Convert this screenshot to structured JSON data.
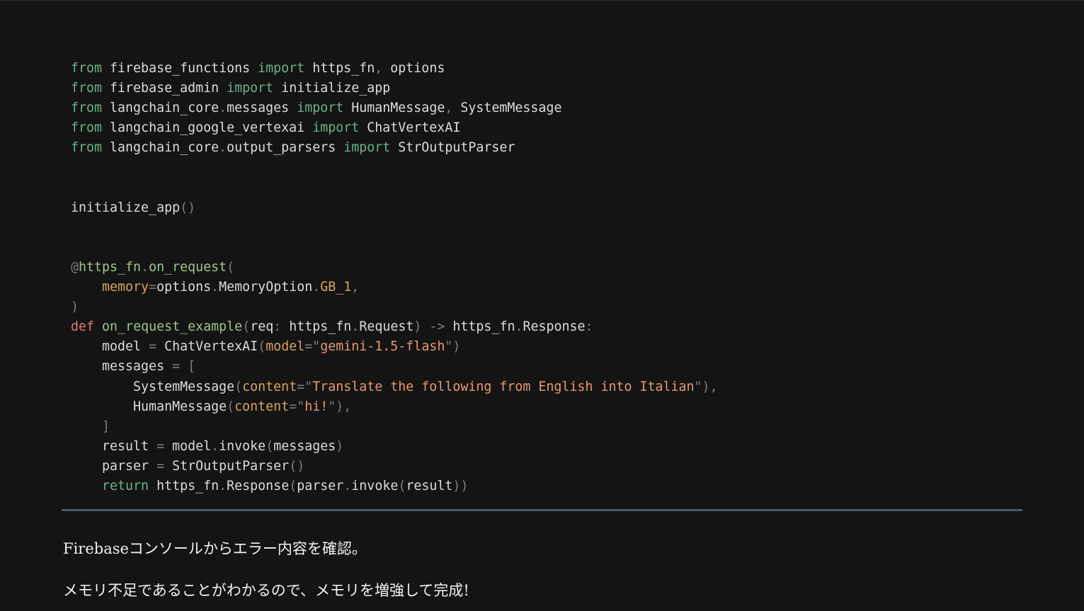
{
  "code": {
    "lines": [
      [
        [
          "kw",
          "from"
        ],
        [
          "name",
          " firebase_functions "
        ],
        [
          "kw",
          "import"
        ],
        [
          "name",
          " https_fn"
        ],
        [
          "punct",
          ","
        ],
        [
          "name",
          " options"
        ]
      ],
      [
        [
          "kw",
          "from"
        ],
        [
          "name",
          " firebase_admin "
        ],
        [
          "kw",
          "import"
        ],
        [
          "name",
          " initialize_app"
        ]
      ],
      [
        [
          "kw",
          "from"
        ],
        [
          "name",
          " langchain_core"
        ],
        [
          "punct",
          "."
        ],
        [
          "name",
          "messages "
        ],
        [
          "kw",
          "import"
        ],
        [
          "name",
          " HumanMessage"
        ],
        [
          "punct",
          ","
        ],
        [
          "name",
          " SystemMessage"
        ]
      ],
      [
        [
          "kw",
          "from"
        ],
        [
          "name",
          " langchain_google_vertexai "
        ],
        [
          "kw",
          "import"
        ],
        [
          "name",
          " ChatVertexAI"
        ]
      ],
      [
        [
          "kw",
          "from"
        ],
        [
          "name",
          " langchain_core"
        ],
        [
          "punct",
          "."
        ],
        [
          "name",
          "output_parsers "
        ],
        [
          "kw",
          "import"
        ],
        [
          "name",
          " StrOutputParser"
        ]
      ],
      [],
      [],
      [
        [
          "name",
          "initialize_app"
        ],
        [
          "punct",
          "()"
        ]
      ],
      [],
      [],
      [
        [
          "punct",
          "@"
        ],
        [
          "fn",
          "https_fn"
        ],
        [
          "punct",
          "."
        ],
        [
          "fn",
          "on_request"
        ],
        [
          "punct",
          "("
        ]
      ],
      [
        [
          "name",
          "    "
        ],
        [
          "param",
          "memory"
        ],
        [
          "punct",
          "="
        ],
        [
          "name",
          "options"
        ],
        [
          "punct",
          "."
        ],
        [
          "name",
          "MemoryOption"
        ],
        [
          "punct",
          "."
        ],
        [
          "attr",
          "GB_1"
        ],
        [
          "punct",
          ","
        ]
      ],
      [
        [
          "punct",
          ")"
        ]
      ],
      [
        [
          "kw2",
          "def"
        ],
        [
          "name",
          " "
        ],
        [
          "fn",
          "on_request_example"
        ],
        [
          "punct",
          "("
        ],
        [
          "name",
          "req"
        ],
        [
          "punct",
          ":"
        ],
        [
          "name",
          " https_fn"
        ],
        [
          "punct",
          "."
        ],
        [
          "name",
          "Request"
        ],
        [
          "punct",
          ")"
        ],
        [
          "name",
          " "
        ],
        [
          "punct",
          "->"
        ],
        [
          "name",
          " https_fn"
        ],
        [
          "punct",
          "."
        ],
        [
          "name",
          "Response"
        ],
        [
          "punct",
          ":"
        ]
      ],
      [
        [
          "name",
          "    model "
        ],
        [
          "punct",
          "="
        ],
        [
          "name",
          " ChatVertexAI"
        ],
        [
          "punct",
          "("
        ],
        [
          "param",
          "model"
        ],
        [
          "punct",
          "=\""
        ],
        [
          "str",
          "gemini-1.5-flash"
        ],
        [
          "punct",
          "\")"
        ]
      ],
      [
        [
          "name",
          "    messages "
        ],
        [
          "punct",
          "="
        ],
        [
          "name",
          " "
        ],
        [
          "punct",
          "["
        ]
      ],
      [
        [
          "name",
          "        SystemMessage"
        ],
        [
          "punct",
          "("
        ],
        [
          "param",
          "content"
        ],
        [
          "punct",
          "=\""
        ],
        [
          "str",
          "Translate the following from English into Italian"
        ],
        [
          "punct",
          "\"),"
        ]
      ],
      [
        [
          "name",
          "        HumanMessage"
        ],
        [
          "punct",
          "("
        ],
        [
          "param",
          "content"
        ],
        [
          "punct",
          "=\""
        ],
        [
          "str",
          "hi!"
        ],
        [
          "punct",
          "\"),"
        ]
      ],
      [
        [
          "name",
          "    "
        ],
        [
          "punct",
          "]"
        ]
      ],
      [
        [
          "name",
          "    result "
        ],
        [
          "punct",
          "="
        ],
        [
          "name",
          " model"
        ],
        [
          "punct",
          "."
        ],
        [
          "name",
          "invoke"
        ],
        [
          "punct",
          "("
        ],
        [
          "name",
          "messages"
        ],
        [
          "punct",
          ")"
        ]
      ],
      [
        [
          "name",
          "    parser "
        ],
        [
          "punct",
          "="
        ],
        [
          "name",
          " StrOutputParser"
        ],
        [
          "punct",
          "()"
        ]
      ],
      [
        [
          "name",
          "    "
        ],
        [
          "kw",
          "return"
        ],
        [
          "name",
          " https_fn"
        ],
        [
          "punct",
          "."
        ],
        [
          "name",
          "Response"
        ],
        [
          "punct",
          "("
        ],
        [
          "name",
          "parser"
        ],
        [
          "punct",
          "."
        ],
        [
          "name",
          "invoke"
        ],
        [
          "punct",
          "("
        ],
        [
          "name",
          "result"
        ],
        [
          "punct",
          "))"
        ]
      ]
    ]
  },
  "article": {
    "paragraph_1": "Firebaseコンソールからエラー内容を確認。",
    "paragraph_2": "メモリ不足であることがわかるので、メモリを増強して完成!"
  },
  "colors": {
    "background": "#141414",
    "keyword": "#6cb28a",
    "def_keyword": "#e07a7a",
    "function": "#9ec68a",
    "string": "#e69a72",
    "param": "#d9a55c",
    "punctuation": "#7d7d7d",
    "divider": "#4a5766"
  }
}
